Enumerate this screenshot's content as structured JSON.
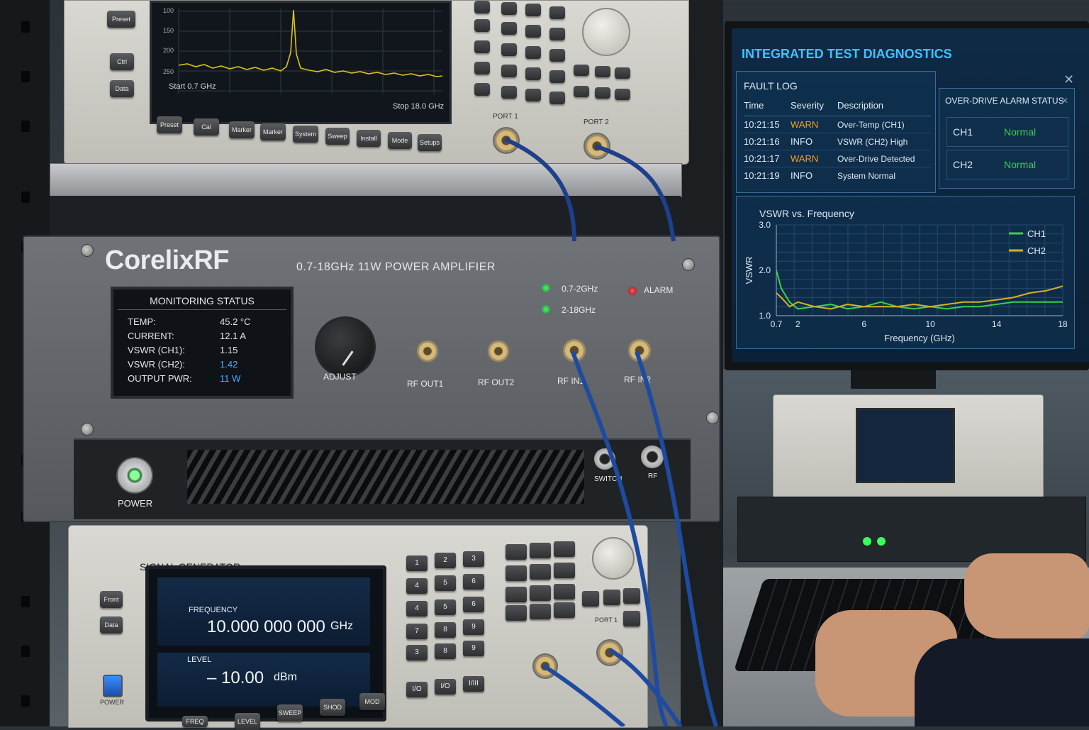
{
  "spectrum_analyzer": {
    "y_ticks": [
      "100",
      "150",
      "200",
      "250"
    ],
    "start_label": "Start 0.7 GHz",
    "stop_label": "Stop 18.0 GHz",
    "side_keys": [
      "Preset",
      "Ctrl",
      "Data"
    ],
    "bottom_keys": [
      "Preset",
      "Cal",
      "Marker",
      "Marker",
      "System",
      "Sweep",
      "Install",
      "Mode",
      "Setups"
    ],
    "port1": "PORT 1",
    "port2": "PORT 2",
    "trace_color": "#d9c21a"
  },
  "amplifier": {
    "brand": "CorelixRF",
    "model": "0.7-18GHz 11W POWER AMPLIFIER",
    "monitor_title": "MONITORING STATUS",
    "rows": [
      {
        "label": "TEMP:",
        "value": "45.2 °C",
        "highlight": false
      },
      {
        "label": "CURRENT:",
        "value": "12.1 A",
        "highlight": false
      },
      {
        "label": "VSWR (CH1):",
        "value": "1.15",
        "highlight": false
      },
      {
        "label": "VSWR (CH2):",
        "value": "1.42",
        "highlight": true
      },
      {
        "label": "OUTPUT PWR:",
        "value": "11 W",
        "highlight": true
      }
    ],
    "adjust_label": "ADJUST",
    "ports": [
      "RF OUT1",
      "RF OUT2",
      "RF IN1",
      "RF IN2"
    ],
    "band1_label": "0.7-2GHz",
    "band2_label": "2-18GHz",
    "alarm_label": "ALARM",
    "power_label": "POWER",
    "switch_label": "SWITCH",
    "rf_label": "RF",
    "led_green": "#2bd14a",
    "led_red": "#e32020"
  },
  "diagnostics": {
    "title": "INTEGRATED TEST DIAGNOSTICS",
    "fault_log_title": "FAULT LOG",
    "columns": [
      "Time",
      "Severity",
      "Description"
    ],
    "rows": [
      {
        "time": "10:21:15",
        "severity": "WARN",
        "description": "Over-Temp (CH1)"
      },
      {
        "time": "10:21:16",
        "severity": "INFO",
        "description": "VSWR (CH2) High"
      },
      {
        "time": "10:21:17",
        "severity": "WARN",
        "description": "Over-Drive Detected"
      },
      {
        "time": "10:21:19",
        "severity": "INFO",
        "description": "System Normal"
      }
    ],
    "alarm_title": "OVER-DRIVE ALARM STATUS",
    "alarm_rows": [
      {
        "channel": "CH1",
        "status": "Normal"
      },
      {
        "channel": "CH2",
        "status": "Normal"
      }
    ],
    "warn_color": "#f0a21e",
    "normal_color": "#3ad14a",
    "chart_data": {
      "type": "line",
      "title": "VSWR vs. Frequency",
      "xlabel": "Frequency (GHz)",
      "ylabel": "VSWR",
      "x_ticks": [
        "0.7",
        "2",
        "6",
        "10",
        "14",
        "18"
      ],
      "y_ticks": [
        "1.0",
        "2.0",
        "3.0"
      ],
      "ylim": [
        1.0,
        3.0
      ],
      "x": [
        0.7,
        1,
        1.5,
        2,
        3,
        4,
        5,
        6,
        7,
        8,
        9,
        10,
        11,
        12,
        13,
        14,
        15,
        16,
        17,
        18
      ],
      "series": [
        {
          "name": "CH1",
          "color": "#3ad14a",
          "values": [
            2.0,
            1.6,
            1.3,
            1.15,
            1.2,
            1.25,
            1.15,
            1.2,
            1.3,
            1.2,
            1.15,
            1.2,
            1.15,
            1.2,
            1.2,
            1.25,
            1.3,
            1.3,
            1.3,
            1.3
          ]
        },
        {
          "name": "CH2",
          "color": "#d8b21c",
          "values": [
            1.5,
            1.4,
            1.2,
            1.3,
            1.2,
            1.15,
            1.25,
            1.2,
            1.2,
            1.2,
            1.25,
            1.2,
            1.25,
            1.3,
            1.3,
            1.35,
            1.4,
            1.5,
            1.55,
            1.65
          ]
        }
      ],
      "legend": "top-right",
      "grid": true
    }
  },
  "signal_generator": {
    "title": "SIGNAL GENERATOR",
    "freq_label": "FREQUENCY",
    "freq_value": "10.000 000 000",
    "freq_unit": "GHz",
    "level_label": "LEVEL",
    "level_value": "– 10.00",
    "level_unit": "dBm",
    "side_keys": [
      "Front",
      "Data"
    ],
    "bottom_keys": [
      "FREQ",
      "LEVEL",
      "SWEEP",
      "SHOD",
      "MOD"
    ],
    "keypad": [
      "1",
      "2",
      "3",
      "4",
      "5",
      "6",
      "4",
      "5",
      "6",
      "7",
      "8",
      "9",
      "3",
      "8",
      "9"
    ],
    "right_keys": [
      "I/O",
      "I/O",
      "I/III"
    ],
    "port_label": "PORT 1",
    "power_label": "POWER"
  }
}
